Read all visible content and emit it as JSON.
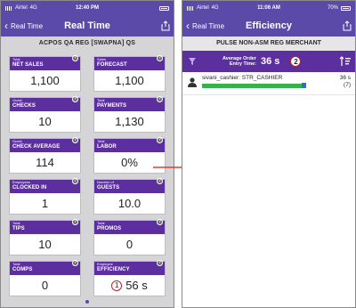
{
  "left_screen": {
    "status": {
      "carrier": "Airtel",
      "network": "4G",
      "time": "12:40 PM"
    },
    "nav": {
      "back_label": "Real Time",
      "title": "Real Time"
    },
    "subheader": "ACPOS QA REG [SWAPNA] QS",
    "tiles": [
      {
        "caption": "Total",
        "label": "NET SALES",
        "value": "1,100"
      },
      {
        "caption": "Sales",
        "label": "FORECAST",
        "value": "1,100"
      },
      {
        "caption": "Guest",
        "label": "CHECKS",
        "value": "10"
      },
      {
        "caption": "Total",
        "label": "PAYMENTS",
        "value": "1,130"
      },
      {
        "caption": "Guest",
        "label": "CHECK AVERAGE",
        "value": "114"
      },
      {
        "caption": "Total",
        "label": "LABOR",
        "value": "0%"
      },
      {
        "caption": "Employees",
        "label": "CLOCKED IN",
        "value": "1"
      },
      {
        "caption": "Number of",
        "label": "GUESTS",
        "value": "10.0"
      },
      {
        "caption": "Total",
        "label": "TIPS",
        "value": "10"
      },
      {
        "caption": "Total",
        "label": "PROMOS",
        "value": "0"
      },
      {
        "caption": "Total",
        "label": "COMPS",
        "value": "0"
      },
      {
        "caption": "Employee",
        "label": "EFFICIENCY",
        "value": "56 s",
        "badge": "1"
      }
    ],
    "info_glyph": "?"
  },
  "right_screen": {
    "status": {
      "carrier": "Airtel",
      "network": "4G",
      "time": "11:06 AM",
      "battery": "70%"
    },
    "nav": {
      "back_label": "Real Time",
      "title": "Efficiency"
    },
    "subheader": "PULSE NON-ASM REG MERCHANT",
    "avg": {
      "label_line1": "Average Order",
      "label_line2": "Entry Time:",
      "value": "36 s",
      "badge": "2"
    },
    "employees": [
      {
        "name": "sivani_cashier: STR_CASHIER",
        "time": "36 s",
        "count": "(7)",
        "bar_fill": 1.0
      }
    ]
  },
  "colors": {
    "nav": "#5b4aa8",
    "tile_header": "#5b2f9e",
    "bar": "#34b34a",
    "arrow": "#e53b2c"
  },
  "icons": [
    "chevron-left-icon",
    "share-icon",
    "info-icon",
    "filter-icon",
    "sort-icon",
    "avatar-icon",
    "arrow-right-icon"
  ]
}
